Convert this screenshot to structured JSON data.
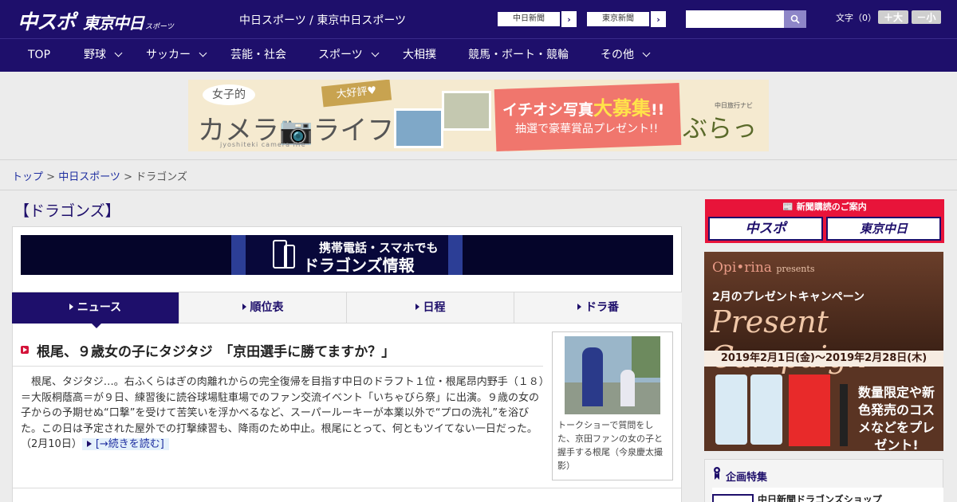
{
  "header": {
    "logo_main": "中スポ",
    "logo_sub": "東京中日",
    "logo_sub_small": "スポーツ",
    "site_title": "中日スポーツ / 東京中日スポーツ",
    "btn_chunichi": "中日新聞",
    "btn_tokyo": "東京新聞",
    "search_placeholder": "",
    "font_label": "文字（0）",
    "font_larger": "＋大",
    "font_smaller": "－小"
  },
  "nav": {
    "items": [
      {
        "label": "TOP"
      },
      {
        "label": "野球"
      },
      {
        "label": "サッカー"
      },
      {
        "label": "芸能・社会"
      },
      {
        "label": "スポーツ"
      },
      {
        "label": "大相撲"
      },
      {
        "label": "競馬・ボート・競輪"
      },
      {
        "label": "その他"
      }
    ]
  },
  "banner": {
    "girl": "女子的",
    "camera": "カメラ📷ライフ",
    "sub": "jyoshiteki camera life",
    "tag": "大好評♥",
    "headline_pre": "イチオシ写真",
    "headline_big": "大募集",
    "headline_post": "!!",
    "prize": "抽選で豪華賞品プレゼント!!",
    "nav_small": "中日旅行ナビ",
    "nav_logo": "ぶらっ人"
  },
  "breadcrumb": {
    "home": "トップ",
    "section": "中日スポーツ",
    "current": "ドラゴンズ",
    "sep": " > "
  },
  "main": {
    "page_title": "【ドラゴンズ】",
    "mobile_banner_line1": "携帯電話・スマホでも",
    "mobile_banner_line2": "ドラゴンズ情報",
    "tabs": [
      {
        "label": "ニュース"
      },
      {
        "label": "順位表"
      },
      {
        "label": "日程"
      },
      {
        "label": "ドラ番"
      }
    ],
    "article": {
      "headline": "根尾、９歳女の子にタジタジ　「京田選手に勝てますか？」",
      "body": "　根尾、タジタジ…。右ふくらはぎの肉離れからの完全復帰を目指す中日のドラフト１位・根尾昂内野手（１８）＝大阪桐蔭高＝が９日、練習後に読谷球場駐車場でのファン交流イベント「いちゃびら祭」に出演。９歳の女の子からの予期せぬ“口撃”を受けて苦笑いを浮かべるなど、スーパールーキーが本業以外で“プロの洗礼”を浴びた。この日は予定された屋外での打撃練習も、降雨のため中止。根尾にとって、何ともツイてない一日だった。",
      "date": "（2月10日）",
      "more": "[→続きを読む]",
      "photo_caption": "トークショーで質問をした、京田ファンの女の子と握手する根尾（今泉慶太撮影）"
    }
  },
  "sidebar": {
    "subscribe_title": "📰 新聞購読のご案内",
    "sub_logo_1": "中スポ",
    "sub_logo_2": "東京中日",
    "ad": {
      "brand": "Opi•rina",
      "brand_presents": "presents",
      "campaign": "2月のプレゼントキャンペーン",
      "title": "Present Campaign",
      "date": "2019年2月1日(金)～2019年2月28日(木)",
      "promo": "数量限定や新色発売のコスメなどをプレゼント!"
    },
    "plan_title": "企画特集",
    "plan_item": "中日新聞ドラゴンズショップ"
  },
  "colors": {
    "header_bg": "#1e0f6b",
    "accent_red": "#d4143a",
    "link": "#1e2ea0"
  }
}
